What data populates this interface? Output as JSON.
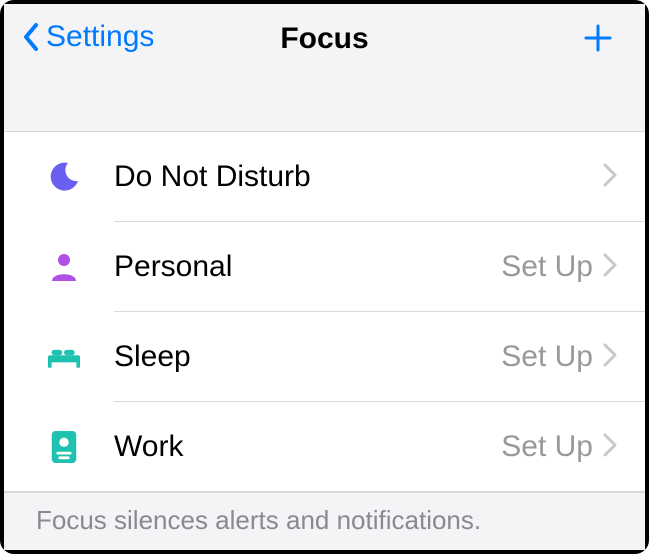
{
  "header": {
    "back_label": "Settings",
    "title": "Focus"
  },
  "rows": [
    {
      "label": "Do Not Disturb",
      "detail": "",
      "icon": "moon",
      "iconColor": "#6a5ff0"
    },
    {
      "label": "Personal",
      "detail": "Set Up",
      "icon": "person",
      "iconColor": "#b04fe6"
    },
    {
      "label": "Sleep",
      "detail": "Set Up",
      "icon": "bed",
      "iconColor": "#1fc1b0"
    },
    {
      "label": "Work",
      "detail": "Set Up",
      "icon": "badge",
      "iconColor": "#1fc1b0"
    }
  ],
  "footer": {
    "text": "Focus silences alerts and notifications."
  }
}
